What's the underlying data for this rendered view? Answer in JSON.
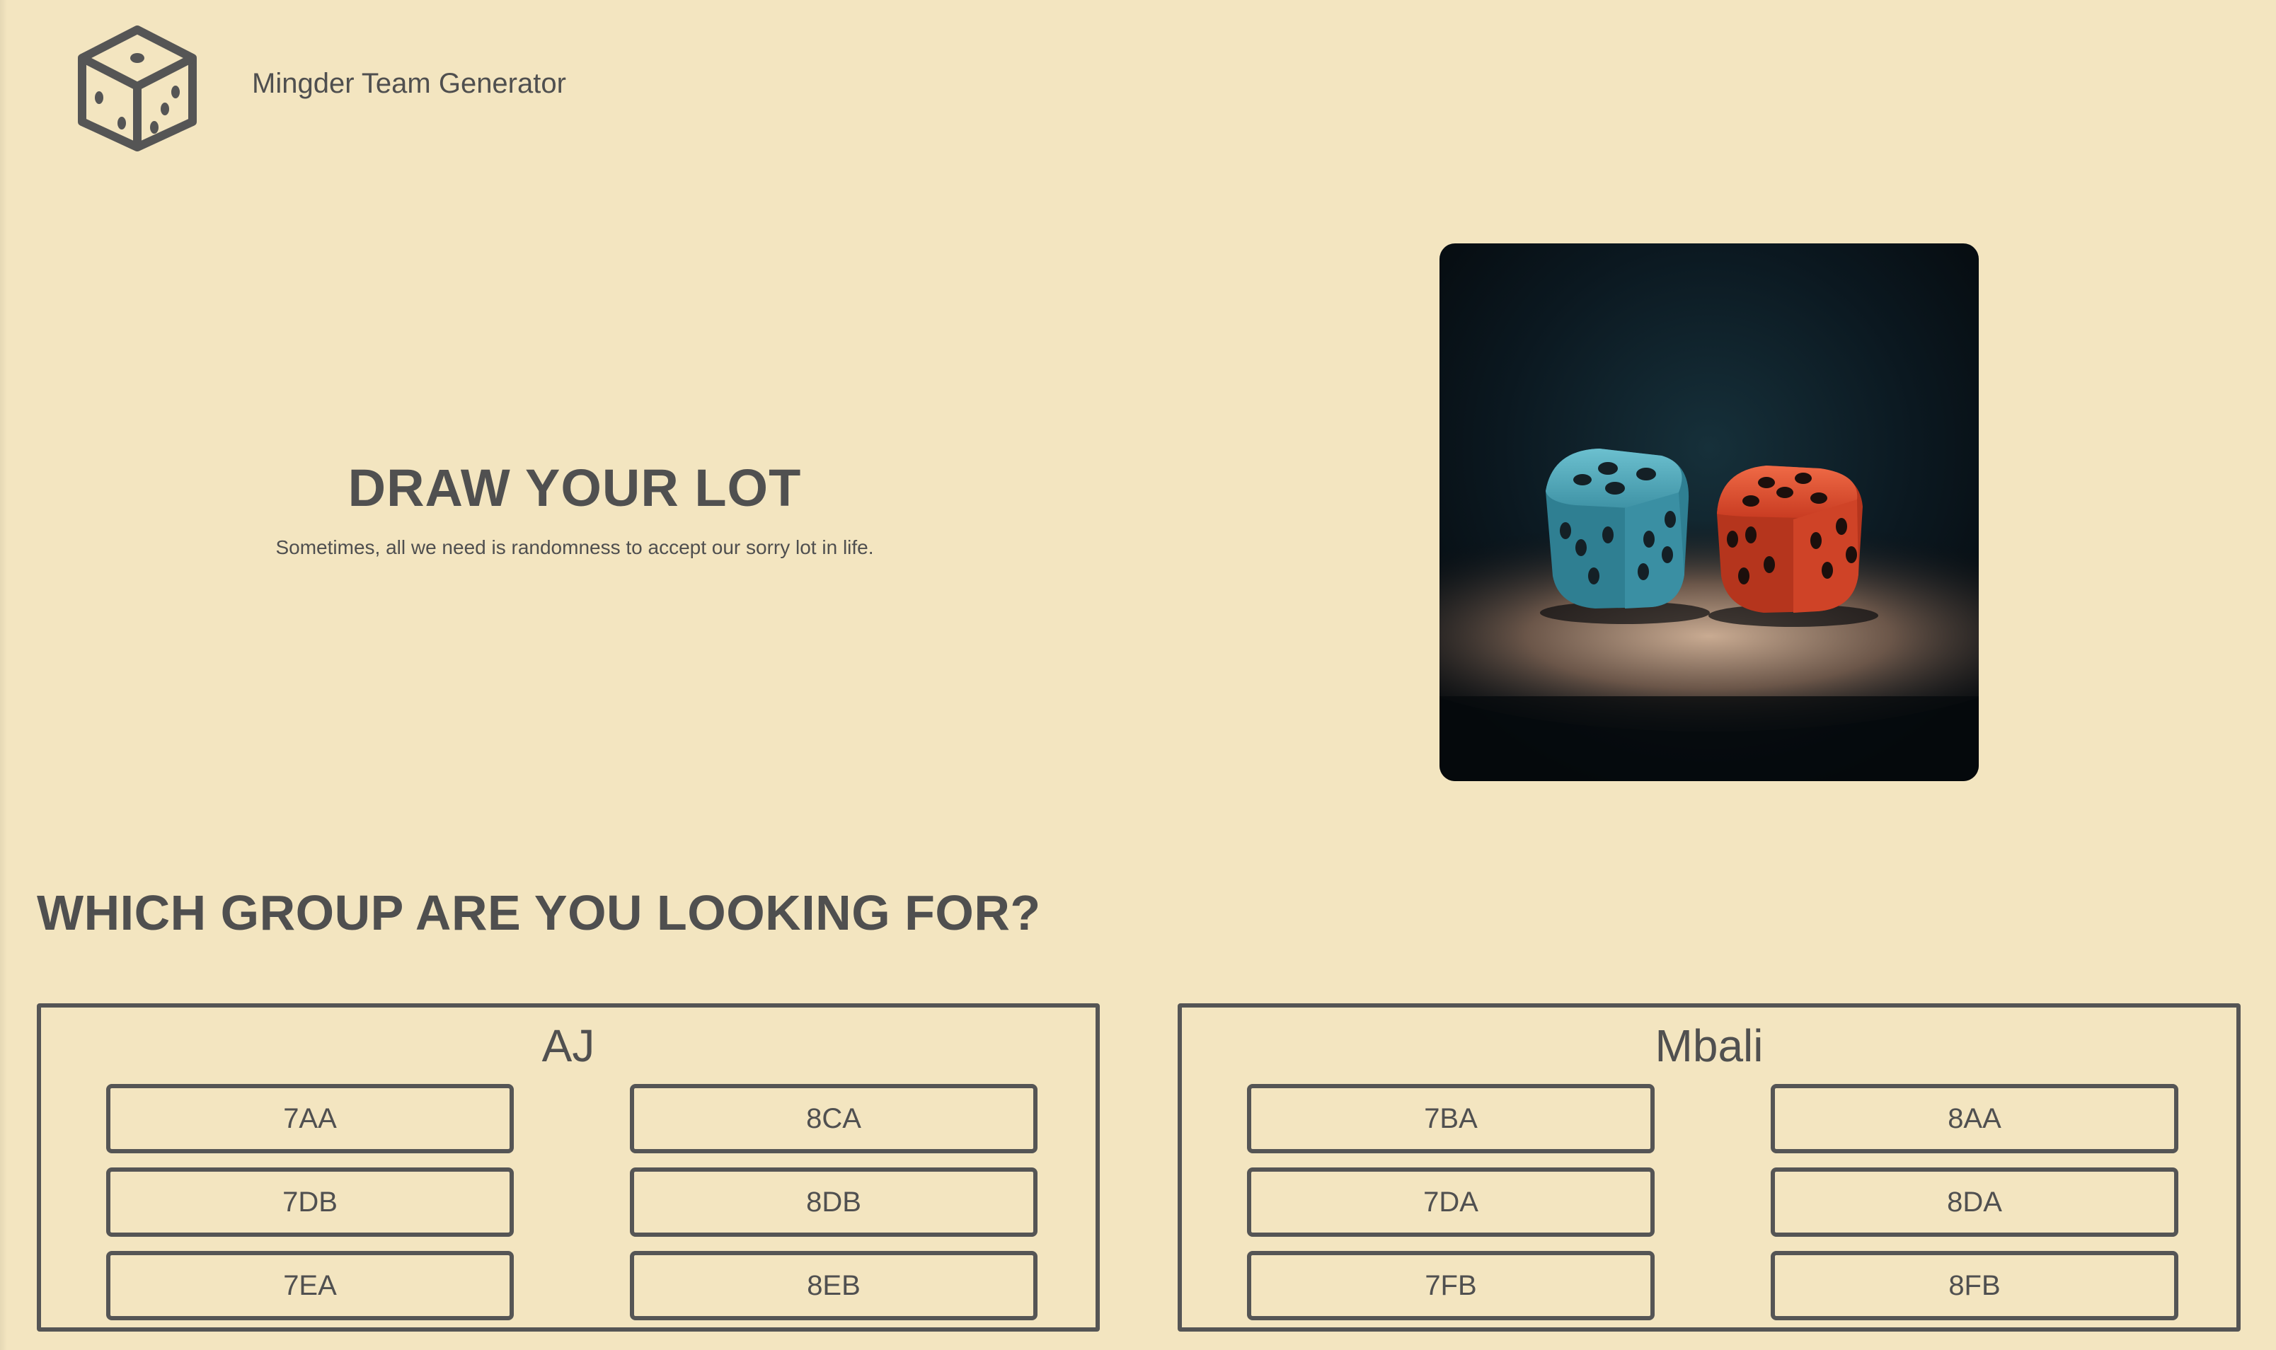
{
  "header": {
    "logo_icon": "dice-icon",
    "brand_name": "Mingder Team Generator"
  },
  "hero": {
    "title": "DRAW YOUR LOT",
    "subtitle": "Sometimes, all we need is randomness to accept our sorry lot in life.",
    "image_icon": "two-dice-photo",
    "dice_colors": [
      "#3f93a6",
      "#d9492b"
    ]
  },
  "groups_section": {
    "title": "WHICH GROUP ARE YOU LOOKING FOR?",
    "panels": [
      {
        "name": "AJ",
        "classes": [
          "7AA",
          "8CA",
          "7DB",
          "8DB",
          "7EA",
          "8EB"
        ]
      },
      {
        "name": "Mbali",
        "classes": [
          "7BA",
          "8AA",
          "7DA",
          "8DA",
          "7FB",
          "8FB"
        ]
      }
    ]
  },
  "colors": {
    "background": "#f3e5c0",
    "text": "#4f4f4f",
    "border": "#555555"
  }
}
